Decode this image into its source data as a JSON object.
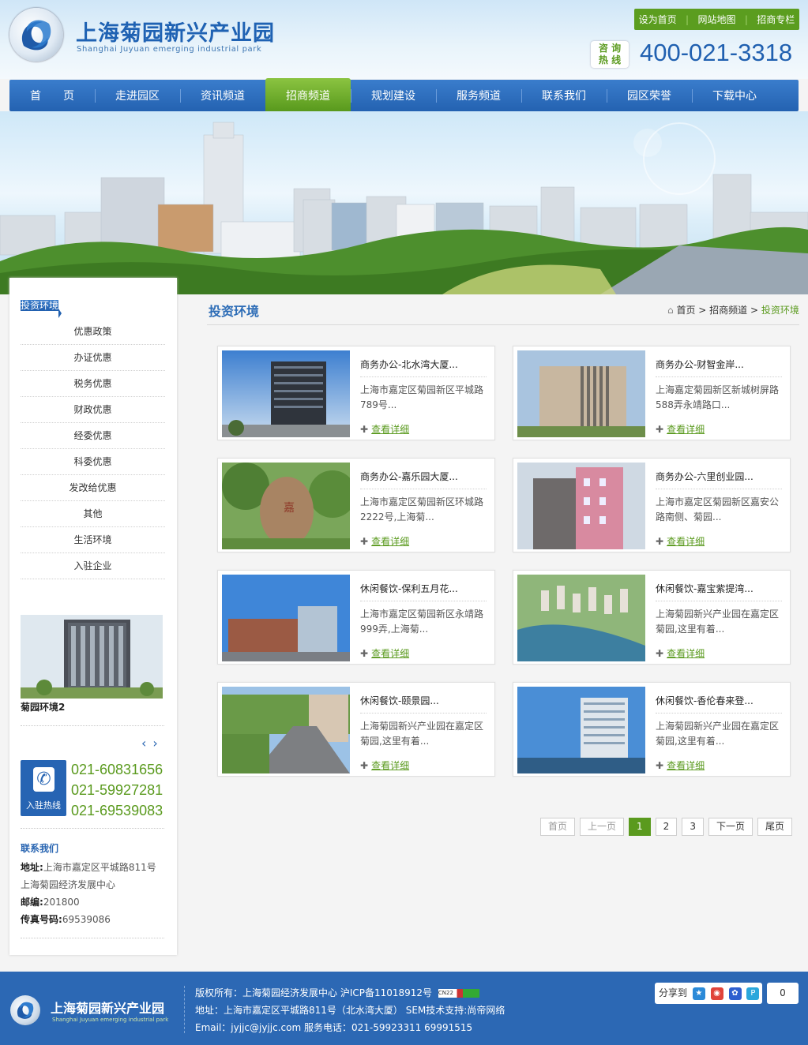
{
  "header": {
    "brand_cn": "上海菊园新兴产业园",
    "brand_en": "Shanghai Juyuan emerging industrial park",
    "top_links": [
      "设为首页",
      "网站地图",
      "招商专栏"
    ],
    "hotline_label_1": "咨 询",
    "hotline_label_2": "热 线",
    "hotline": "400-021-3318"
  },
  "nav": [
    {
      "label": "首　　页"
    },
    {
      "label": "走进园区"
    },
    {
      "label": "资讯频道"
    },
    {
      "label": "招商频道",
      "active": true
    },
    {
      "label": "规划建设"
    },
    {
      "label": "服务频道"
    },
    {
      "label": "联系我们"
    },
    {
      "label": "园区荣誉"
    },
    {
      "label": "下载中心"
    }
  ],
  "sidebar": {
    "menu": [
      "投资环境",
      "优惠政策",
      "办证优惠",
      "税务优惠",
      "财政优惠",
      "经委优惠",
      "科委优惠",
      "发改给优惠",
      "其他",
      "生活环境",
      "入驻企业"
    ],
    "photo_caption": "菊园环境2",
    "arrow_prev": "‹",
    "arrow_next": "›",
    "hotline_label": "入驻热线",
    "phones": [
      "021-60831656",
      "021-59927281",
      "021-69539083"
    ],
    "contact_title": "联系我们",
    "address_label": "地址:",
    "address_1": "上海市嘉定区平城路811号",
    "address_2": "上海菊园经济发展中心",
    "zip_label": "邮编:",
    "zip": "201800",
    "fax_label": "传真号码:",
    "fax": "69539086"
  },
  "main": {
    "title": "投资环境",
    "breadcrumb": [
      "首页",
      "招商频道",
      "投资环境"
    ],
    "more_label": "查看详细",
    "cards": [
      {
        "title": "商务办公-北水湾大厦...",
        "desc": "上海市嘉定区菊园新区平城路789号..."
      },
      {
        "title": "商务办公-财智金岸...",
        "desc": "上海嘉定菊园新区新城树屏路588弄永靖路口..."
      },
      {
        "title": "商务办公-嘉乐园大厦...",
        "desc": "上海市嘉定区菊园新区环城路2222号,上海菊..."
      },
      {
        "title": "商务办公-六里创业园...",
        "desc": "上海市嘉定区菊园新区嘉安公路南侧、菊园..."
      },
      {
        "title": "休闲餐饮-保利五月花...",
        "desc": "上海市嘉定区菊园新区永靖路999弄,上海菊..."
      },
      {
        "title": "休闲餐饮-嘉宝紫提湾...",
        "desc": "上海菊园新兴产业园在嘉定区菊园,这里有着..."
      },
      {
        "title": "休闲餐饮-颐景园...",
        "desc": "上海菊园新兴产业园在嘉定区菊园,这里有着..."
      },
      {
        "title": "休闲餐饮-香伦春来登...",
        "desc": "上海菊园新兴产业园在嘉定区菊园,这里有着..."
      }
    ],
    "pager": {
      "first": "首页",
      "prev": "上一页",
      "pages": [
        "1",
        "2",
        "3"
      ],
      "current": "1",
      "next": "下一页",
      "last": "尾页"
    }
  },
  "footer": {
    "brand_cn": "上海菊园新兴产业园",
    "brand_en": "Shanghai Juyuan emerging industrial park",
    "line1": "版权所有：上海菊园经济发展中心  沪ICP备11018912号",
    "line2": "地址：上海市嘉定区平城路811号（北水湾大厦）  SEM技术支持:尚帝网络",
    "line3": "Email：jyjjc@jyjjc.com 服务电话：021-59923311 69991515",
    "share_label": "分享到",
    "share_count": "0"
  },
  "colors": {
    "primary_blue": "#2462b1",
    "accent_green": "#5a9a1e",
    "footer_blue": "#2c68b4"
  }
}
